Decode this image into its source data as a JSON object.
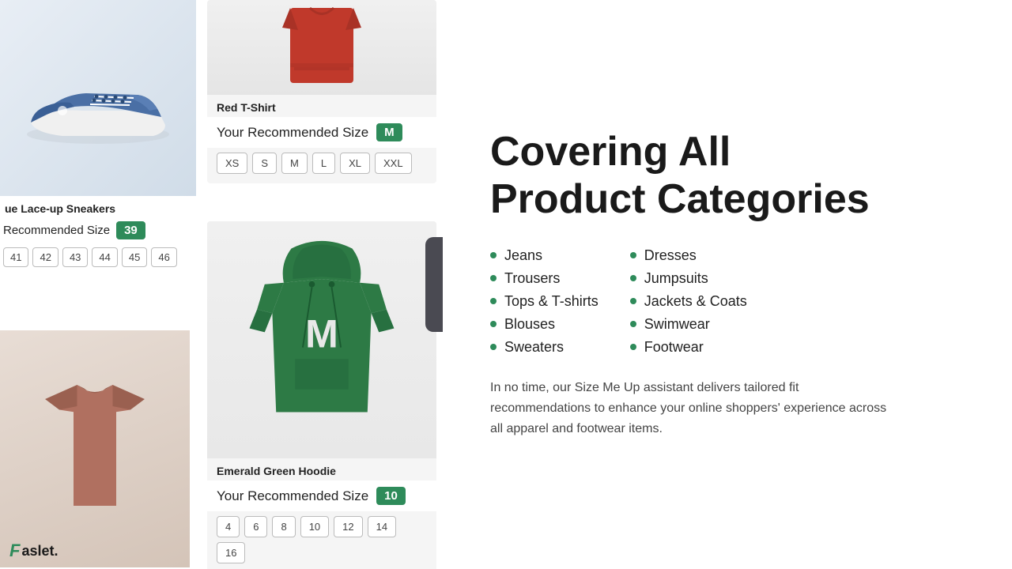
{
  "leftPanel": {
    "sneakerCard": {
      "label": "ue Lace-up Sneakers",
      "recommendedSizeText": "Recommended Size",
      "recommendedSizeValue": "39",
      "sizeOptions": [
        "41",
        "42",
        "43",
        "44",
        "45",
        "46"
      ]
    },
    "redTshirtCard": {
      "label": "Red T-Shirt",
      "recommendedSizeText": "Your Recommended Size",
      "recommendedSizeValue": "M",
      "sizeOptions": [
        "XS",
        "S",
        "M",
        "L",
        "XL",
        "XXL"
      ]
    },
    "greenHoodieCard": {
      "label": "Emerald Green Hoodie",
      "recommendedSizeText": "Your Recommended Size",
      "recommendedSizeValue": "10",
      "sizeOptions": [
        "4",
        "6",
        "8",
        "10",
        "12",
        "14",
        "16"
      ]
    },
    "logo": "Faslet."
  },
  "rightPanel": {
    "heading": {
      "line1": "Covering All",
      "line2": "Product Categories"
    },
    "categoriesLeft": [
      "Jeans",
      "Trousers",
      "Tops & T-shirts",
      "Blouses",
      "Sweaters"
    ],
    "categoriesRight": [
      "Dresses",
      "Jumpsuits",
      "Jackets & Coats",
      "Swimwear",
      "Footwear"
    ],
    "description": "In no time, our Size Me Up assistant delivers tailored fit recommendations to enhance your online shoppers' experience across all apparel and footwear items."
  }
}
